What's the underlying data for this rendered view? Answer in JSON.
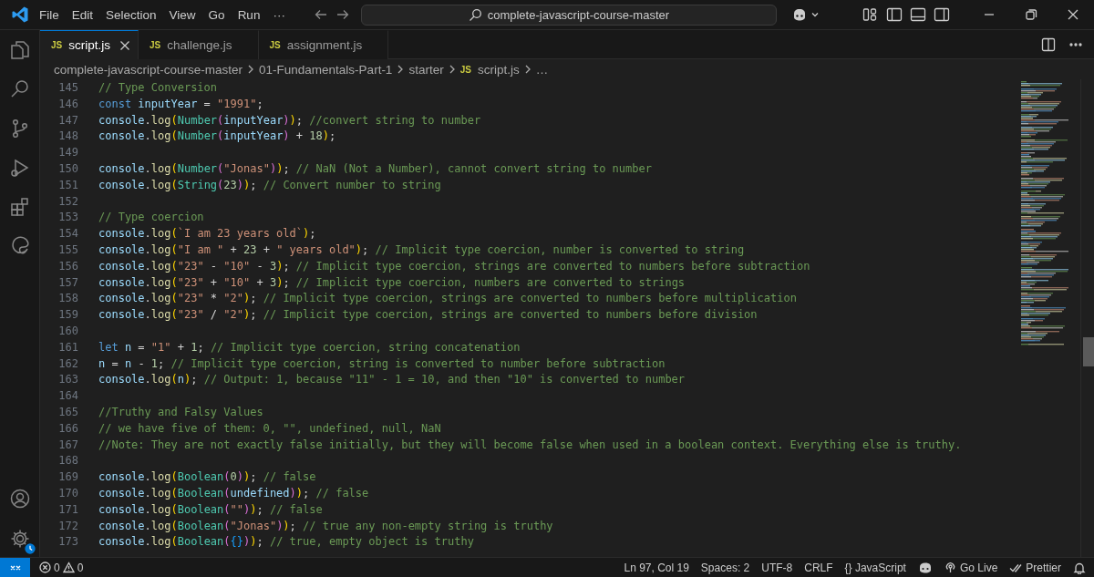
{
  "title_bar": {
    "menu": [
      "File",
      "Edit",
      "Selection",
      "View",
      "Go",
      "Run",
      "···"
    ],
    "command_center": "complete-javascript-course-master"
  },
  "tabs": [
    {
      "badge": "JS",
      "label": "script.js",
      "selected": true
    },
    {
      "badge": "JS",
      "label": "challenge.js",
      "selected": false
    },
    {
      "badge": "JS",
      "label": "assignment.js",
      "selected": false
    }
  ],
  "breadcrumb": [
    {
      "label": "complete-javascript-course-master"
    },
    {
      "label": "01-Fundamentals-Part-1"
    },
    {
      "label": "starter"
    },
    {
      "label": "script.js",
      "badge": "JS"
    },
    {
      "label": "…"
    }
  ],
  "editor": {
    "lines": [
      {
        "number": "145",
        "tokens": [
          {
            "kind": "cm",
            "text": "// Type Conversion"
          }
        ]
      },
      {
        "number": "146",
        "tokens": [
          {
            "kind": "kw",
            "text": "const"
          },
          {
            "kind": "var",
            "text": " inputYear"
          },
          {
            "kind": "pl",
            "text": " = "
          },
          {
            "kind": "str",
            "text": "\"1991\""
          },
          {
            "kind": "pl",
            "text": ";"
          }
        ]
      },
      {
        "number": "147",
        "tokens": [
          {
            "kind": "var",
            "text": "console"
          },
          {
            "kind": "pl",
            "text": "."
          },
          {
            "kind": "fn",
            "text": "log"
          },
          {
            "kind": "br1",
            "text": "("
          },
          {
            "kind": "cls",
            "text": "Number"
          },
          {
            "kind": "br2",
            "text": "("
          },
          {
            "kind": "var",
            "text": "inputYear"
          },
          {
            "kind": "br2",
            "text": ")"
          },
          {
            "kind": "br1",
            "text": ")"
          },
          {
            "kind": "pl",
            "text": "; "
          },
          {
            "kind": "cm",
            "text": "//convert string to number"
          }
        ]
      },
      {
        "number": "148",
        "tokens": [
          {
            "kind": "var",
            "text": "console"
          },
          {
            "kind": "pl",
            "text": "."
          },
          {
            "kind": "fn",
            "text": "log"
          },
          {
            "kind": "br1",
            "text": "("
          },
          {
            "kind": "cls",
            "text": "Number"
          },
          {
            "kind": "br2",
            "text": "("
          },
          {
            "kind": "var",
            "text": "inputYear"
          },
          {
            "kind": "br2",
            "text": ")"
          },
          {
            "kind": "pl",
            "text": " + "
          },
          {
            "kind": "num",
            "text": "18"
          },
          {
            "kind": "br1",
            "text": ")"
          },
          {
            "kind": "pl",
            "text": ";"
          }
        ]
      },
      {
        "number": "149"
      },
      {
        "number": "150",
        "tokens": [
          {
            "kind": "var",
            "text": "console"
          },
          {
            "kind": "pl",
            "text": "."
          },
          {
            "kind": "fn",
            "text": "log"
          },
          {
            "kind": "br1",
            "text": "("
          },
          {
            "kind": "cls",
            "text": "Number"
          },
          {
            "kind": "br2",
            "text": "("
          },
          {
            "kind": "str",
            "text": "\"Jonas\""
          },
          {
            "kind": "br2",
            "text": ")"
          },
          {
            "kind": "br1",
            "text": ")"
          },
          {
            "kind": "pl",
            "text": "; "
          },
          {
            "kind": "cm",
            "text": "// NaN (Not a Number), cannot convert string to number"
          }
        ]
      },
      {
        "number": "151",
        "tokens": [
          {
            "kind": "var",
            "text": "console"
          },
          {
            "kind": "pl",
            "text": "."
          },
          {
            "kind": "fn",
            "text": "log"
          },
          {
            "kind": "br1",
            "text": "("
          },
          {
            "kind": "cls",
            "text": "String"
          },
          {
            "kind": "br2",
            "text": "("
          },
          {
            "kind": "num",
            "text": "23"
          },
          {
            "kind": "br2",
            "text": ")"
          },
          {
            "kind": "br1",
            "text": ")"
          },
          {
            "kind": "pl",
            "text": "; "
          },
          {
            "kind": "cm",
            "text": "// Convert number to string"
          }
        ]
      },
      {
        "number": "152"
      },
      {
        "number": "153",
        "tokens": [
          {
            "kind": "cm",
            "text": "// Type coercion"
          }
        ]
      },
      {
        "number": "154",
        "tokens": [
          {
            "kind": "var",
            "text": "console"
          },
          {
            "kind": "pl",
            "text": "."
          },
          {
            "kind": "fn",
            "text": "log"
          },
          {
            "kind": "br1",
            "text": "("
          },
          {
            "kind": "str",
            "text": "`I am 23 years old`"
          },
          {
            "kind": "br1",
            "text": ")"
          },
          {
            "kind": "pl",
            "text": ";"
          }
        ]
      },
      {
        "number": "155",
        "tokens": [
          {
            "kind": "var",
            "text": "console"
          },
          {
            "kind": "pl",
            "text": "."
          },
          {
            "kind": "fn",
            "text": "log"
          },
          {
            "kind": "br1",
            "text": "("
          },
          {
            "kind": "str",
            "text": "\"I am \""
          },
          {
            "kind": "pl",
            "text": " + "
          },
          {
            "kind": "num",
            "text": "23"
          },
          {
            "kind": "pl",
            "text": " + "
          },
          {
            "kind": "str",
            "text": "\" years old\""
          },
          {
            "kind": "br1",
            "text": ")"
          },
          {
            "kind": "pl",
            "text": "; "
          },
          {
            "kind": "cm",
            "text": "// Implicit type coercion, number is converted to string"
          }
        ]
      },
      {
        "number": "156",
        "tokens": [
          {
            "kind": "var",
            "text": "console"
          },
          {
            "kind": "pl",
            "text": "."
          },
          {
            "kind": "fn",
            "text": "log"
          },
          {
            "kind": "br1",
            "text": "("
          },
          {
            "kind": "str",
            "text": "\"23\""
          },
          {
            "kind": "pl",
            "text": " - "
          },
          {
            "kind": "str",
            "text": "\"10\""
          },
          {
            "kind": "pl",
            "text": " - "
          },
          {
            "kind": "num",
            "text": "3"
          },
          {
            "kind": "br1",
            "text": ")"
          },
          {
            "kind": "pl",
            "text": "; "
          },
          {
            "kind": "cm",
            "text": "// Implicit type coercion, strings are converted to numbers before subtraction"
          }
        ]
      },
      {
        "number": "157",
        "tokens": [
          {
            "kind": "var",
            "text": "console"
          },
          {
            "kind": "pl",
            "text": "."
          },
          {
            "kind": "fn",
            "text": "log"
          },
          {
            "kind": "br1",
            "text": "("
          },
          {
            "kind": "str",
            "text": "\"23\""
          },
          {
            "kind": "pl",
            "text": " + "
          },
          {
            "kind": "str",
            "text": "\"10\""
          },
          {
            "kind": "pl",
            "text": " + "
          },
          {
            "kind": "num",
            "text": "3"
          },
          {
            "kind": "br1",
            "text": ")"
          },
          {
            "kind": "pl",
            "text": "; "
          },
          {
            "kind": "cm",
            "text": "// Implicit type coercion, numbers are converted to strings"
          }
        ]
      },
      {
        "number": "158",
        "tokens": [
          {
            "kind": "var",
            "text": "console"
          },
          {
            "kind": "pl",
            "text": "."
          },
          {
            "kind": "fn",
            "text": "log"
          },
          {
            "kind": "br1",
            "text": "("
          },
          {
            "kind": "str",
            "text": "\"23\""
          },
          {
            "kind": "pl",
            "text": " * "
          },
          {
            "kind": "str",
            "text": "\"2\""
          },
          {
            "kind": "br1",
            "text": ")"
          },
          {
            "kind": "pl",
            "text": "; "
          },
          {
            "kind": "cm",
            "text": "// Implicit type coercion, strings are converted to numbers before multiplication"
          }
        ]
      },
      {
        "number": "159",
        "tokens": [
          {
            "kind": "var",
            "text": "console"
          },
          {
            "kind": "pl",
            "text": "."
          },
          {
            "kind": "fn",
            "text": "log"
          },
          {
            "kind": "br1",
            "text": "("
          },
          {
            "kind": "str",
            "text": "\"23\""
          },
          {
            "kind": "pl",
            "text": " / "
          },
          {
            "kind": "str",
            "text": "\"2\""
          },
          {
            "kind": "br1",
            "text": ")"
          },
          {
            "kind": "pl",
            "text": "; "
          },
          {
            "kind": "cm",
            "text": "// Implicit type coercion, strings are converted to numbers before division"
          }
        ]
      },
      {
        "number": "160"
      },
      {
        "number": "161",
        "tokens": [
          {
            "kind": "kw",
            "text": "let"
          },
          {
            "kind": "var",
            "text": " n"
          },
          {
            "kind": "pl",
            "text": " = "
          },
          {
            "kind": "str",
            "text": "\"1\""
          },
          {
            "kind": "pl",
            "text": " + "
          },
          {
            "kind": "num",
            "text": "1"
          },
          {
            "kind": "pl",
            "text": "; "
          },
          {
            "kind": "cm",
            "text": "// Implicit type coercion, string concatenation"
          }
        ]
      },
      {
        "number": "162",
        "tokens": [
          {
            "kind": "var",
            "text": "n"
          },
          {
            "kind": "pl",
            "text": " = "
          },
          {
            "kind": "var",
            "text": "n"
          },
          {
            "kind": "pl",
            "text": " - "
          },
          {
            "kind": "num",
            "text": "1"
          },
          {
            "kind": "pl",
            "text": "; "
          },
          {
            "kind": "cm",
            "text": "// Implicit type coercion, string is converted to number before subtraction"
          }
        ]
      },
      {
        "number": "163",
        "tokens": [
          {
            "kind": "var",
            "text": "console"
          },
          {
            "kind": "pl",
            "text": "."
          },
          {
            "kind": "fn",
            "text": "log"
          },
          {
            "kind": "br1",
            "text": "("
          },
          {
            "kind": "var",
            "text": "n"
          },
          {
            "kind": "br1",
            "text": ")"
          },
          {
            "kind": "pl",
            "text": "; "
          },
          {
            "kind": "cm",
            "text": "// Output: 1, because \"11\" - 1 = 10, and then \"10\" is converted to number"
          }
        ]
      },
      {
        "number": "164"
      },
      {
        "number": "165",
        "tokens": [
          {
            "kind": "cm",
            "text": "//Truthy and Falsy Values"
          }
        ]
      },
      {
        "number": "166",
        "tokens": [
          {
            "kind": "cm",
            "text": "// we have five of them: 0, \"\", undefined, null, NaN"
          }
        ]
      },
      {
        "number": "167",
        "tokens": [
          {
            "kind": "cm",
            "text": "//Note: They are not exactly false initially, but they will become false when used in a boolean context. Everything else is truthy."
          }
        ]
      },
      {
        "number": "168"
      },
      {
        "number": "169",
        "tokens": [
          {
            "kind": "var",
            "text": "console"
          },
          {
            "kind": "pl",
            "text": "."
          },
          {
            "kind": "fn",
            "text": "log"
          },
          {
            "kind": "br1",
            "text": "("
          },
          {
            "kind": "cls",
            "text": "Boolean"
          },
          {
            "kind": "br2",
            "text": "("
          },
          {
            "kind": "num",
            "text": "0"
          },
          {
            "kind": "br2",
            "text": ")"
          },
          {
            "kind": "br1",
            "text": ")"
          },
          {
            "kind": "pl",
            "text": "; "
          },
          {
            "kind": "cm",
            "text": "// false"
          }
        ]
      },
      {
        "number": "170",
        "tokens": [
          {
            "kind": "var",
            "text": "console"
          },
          {
            "kind": "pl",
            "text": "."
          },
          {
            "kind": "fn",
            "text": "log"
          },
          {
            "kind": "br1",
            "text": "("
          },
          {
            "kind": "cls",
            "text": "Boolean"
          },
          {
            "kind": "br2",
            "text": "("
          },
          {
            "kind": "var",
            "text": "undefined"
          },
          {
            "kind": "br2",
            "text": ")"
          },
          {
            "kind": "br1",
            "text": ")"
          },
          {
            "kind": "pl",
            "text": "; "
          },
          {
            "kind": "cm",
            "text": "// false"
          }
        ]
      },
      {
        "number": "171",
        "tokens": [
          {
            "kind": "var",
            "text": "console"
          },
          {
            "kind": "pl",
            "text": "."
          },
          {
            "kind": "fn",
            "text": "log"
          },
          {
            "kind": "br1",
            "text": "("
          },
          {
            "kind": "cls",
            "text": "Boolean"
          },
          {
            "kind": "br2",
            "text": "("
          },
          {
            "kind": "str",
            "text": "\"\""
          },
          {
            "kind": "br2",
            "text": ")"
          },
          {
            "kind": "br1",
            "text": ")"
          },
          {
            "kind": "pl",
            "text": "; "
          },
          {
            "kind": "cm",
            "text": "// false"
          }
        ]
      },
      {
        "number": "172",
        "tokens": [
          {
            "kind": "var",
            "text": "console"
          },
          {
            "kind": "pl",
            "text": "."
          },
          {
            "kind": "fn",
            "text": "log"
          },
          {
            "kind": "br1",
            "text": "("
          },
          {
            "kind": "cls",
            "text": "Boolean"
          },
          {
            "kind": "br2",
            "text": "("
          },
          {
            "kind": "str",
            "text": "\"Jonas\""
          },
          {
            "kind": "br2",
            "text": ")"
          },
          {
            "kind": "br1",
            "text": ")"
          },
          {
            "kind": "pl",
            "text": "; "
          },
          {
            "kind": "cm",
            "text": "// true any non-empty string is truthy"
          }
        ]
      },
      {
        "number": "173",
        "tokens": [
          {
            "kind": "var",
            "text": "console"
          },
          {
            "kind": "pl",
            "text": "."
          },
          {
            "kind": "fn",
            "text": "log"
          },
          {
            "kind": "br1",
            "text": "("
          },
          {
            "kind": "cls",
            "text": "Boolean"
          },
          {
            "kind": "br2",
            "text": "("
          },
          {
            "kind": "br3",
            "text": "{}"
          },
          {
            "kind": "br2",
            "text": ")"
          },
          {
            "kind": "br1",
            "text": ")"
          },
          {
            "kind": "pl",
            "text": "; "
          },
          {
            "kind": "cm",
            "text": "// true, empty object is truthy"
          }
        ]
      }
    ]
  },
  "status_bar": {
    "errors": "0",
    "warnings": "0",
    "items": [
      {
        "kind": "text",
        "label": "Ln 97, Col 19"
      },
      {
        "kind": "text",
        "label": "Spaces: 2"
      },
      {
        "kind": "text",
        "label": "UTF-8"
      },
      {
        "kind": "text",
        "label": "CRLF"
      },
      {
        "kind": "language",
        "glyph": "{}",
        "label": "JavaScript"
      },
      {
        "kind": "copilot"
      },
      {
        "kind": "golive",
        "label": "Go Live"
      },
      {
        "kind": "prettier",
        "label": "Prettier"
      },
      {
        "kind": "bell"
      }
    ]
  }
}
